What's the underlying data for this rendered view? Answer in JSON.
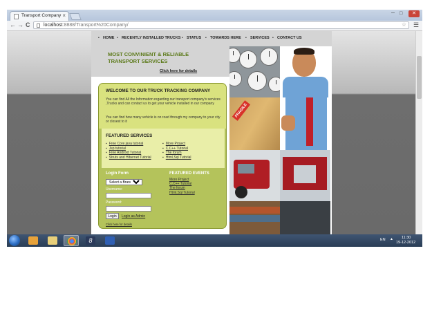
{
  "browser": {
    "tab_title": "Transport Company",
    "tab_close": "×",
    "url_host": "localhost",
    "url_rest": ":8888/Transport%20Company/",
    "nav": {
      "back": "←",
      "forward": "→",
      "reload": "C"
    }
  },
  "site": {
    "nav": [
      "HOME",
      "RECENTLY INSTALLED TRUCKS",
      "STATUS",
      "TOWARDS HERE",
      "SERVICES",
      "CONTACT US"
    ],
    "hero": {
      "headline_line1": "MOST CONVINIENT & RELIABLE",
      "headline_line2": "TRANSPORT SERVICES",
      "details_link": "Click here for details"
    },
    "welcome": {
      "title": "WELCOME TO OUR TRUCK TRACKING COMPANY",
      "para1": "You can find All the Information regarding our transport company's services ,Trucks and can contact us to get your vehicle installed in our company",
      "para2": "You can find how many vehicle is on road through my company to your city or closest to it"
    },
    "featured": {
      "title": "FEATURED SERVICES",
      "left": [
        "Free Core java tutorial",
        "Jsp tutorial",
        "Free Android Tutorial",
        "Struts and Hibernet Tutorial"
      ],
      "right": [
        "More Project",
        "C,C++ Tutorial",
        "The forum",
        "Html,Sql Tutorial"
      ]
    },
    "login": {
      "title": "Login Form",
      "branch_select": "Select a Branch",
      "username_label": "Username:",
      "password_label": "Password:",
      "login_button": "Login",
      "admin_link": "Login as Admin",
      "details_link": "Click here for details"
    },
    "events": {
      "title": "FEATURED EVENTS",
      "items": [
        "More Project",
        "C,C++ Tutorial",
        "The forum",
        "Html,Sql Tutorial"
      ]
    },
    "photo_text": {
      "fragile": "FRAGILE"
    }
  },
  "taskbar": {
    "language": "EN",
    "time": "11:30",
    "date": "19-12-2012"
  },
  "colors": {
    "accent_green": "#b4c35b",
    "headline_green": "#5c7a1a",
    "taskbar": "#2f4562"
  }
}
